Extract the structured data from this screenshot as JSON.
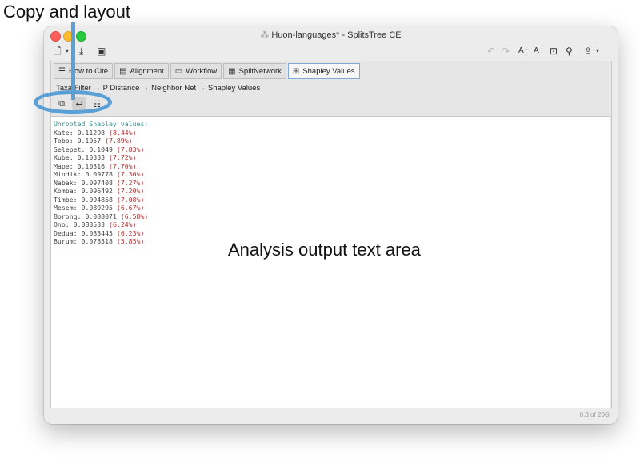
{
  "annotations": {
    "title": "Copy and layout",
    "output_area_label": "Analysis output text area"
  },
  "window": {
    "title": "Huon-languages* - SplitsTree CE",
    "app_icon": "splitstree-icon"
  },
  "toolbar": {
    "zoom_in": "A+",
    "zoom_out": "A−"
  },
  "tabs": [
    {
      "label": "How to Cite",
      "icon": "lines-icon"
    },
    {
      "label": "Alignment",
      "icon": "alignment-icon"
    },
    {
      "label": "Workflow",
      "icon": "workflow-icon"
    },
    {
      "label": "SplitNetwork",
      "icon": "network-icon"
    },
    {
      "label": "Shapley Values",
      "icon": "table-icon",
      "active": true
    }
  ],
  "breadcrumb": "Taxa Filter → P Distance → Neighbor Net → Shapley Values",
  "output": {
    "header": "Unrooted Shapley values:",
    "rows": [
      {
        "name": "Kate",
        "value": "0.11298",
        "pct": "(8.44%)"
      },
      {
        "name": "Tobo",
        "value": "0.1057",
        "pct": "(7.89%)"
      },
      {
        "name": "Selepet",
        "value": "0.1049",
        "pct": "(7.83%)"
      },
      {
        "name": "Kube",
        "value": "0.10333",
        "pct": "(7.72%)"
      },
      {
        "name": "Mape",
        "value": "0.10316",
        "pct": "(7.70%)"
      },
      {
        "name": "Mindik",
        "value": "0.09778",
        "pct": "(7.30%)"
      },
      {
        "name": "Nabak",
        "value": "0.097408",
        "pct": "(7.27%)"
      },
      {
        "name": "Komba",
        "value": "0.096492",
        "pct": "(7.20%)"
      },
      {
        "name": "Timbe",
        "value": "0.094858",
        "pct": "(7.08%)"
      },
      {
        "name": "Mesem",
        "value": "0.089295",
        "pct": "(6.67%)"
      },
      {
        "name": "Borong",
        "value": "0.088071",
        "pct": "(6.58%)"
      },
      {
        "name": "Ono",
        "value": "0.083533",
        "pct": "(6.24%)"
      },
      {
        "name": "Dedua",
        "value": "0.083445",
        "pct": "(6.23%)"
      },
      {
        "name": "Burum",
        "value": "0.078318",
        "pct": "(5.85%)"
      }
    ]
  },
  "status": "0.3 of 20G",
  "colors": {
    "annotation_blue": "#5a9fd6",
    "header_teal": "#3a8f8f",
    "percent_red": "#b03030"
  }
}
